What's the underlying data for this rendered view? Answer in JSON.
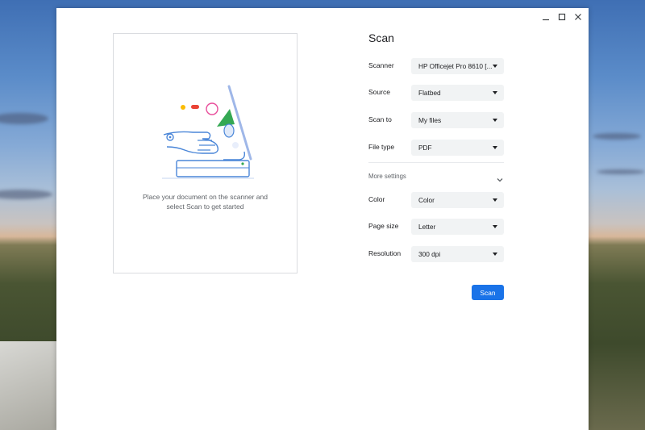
{
  "window_controls": {
    "minimize_icon": "minimize-icon",
    "maximize_icon": "maximize-icon",
    "close_icon": "close-icon"
  },
  "preview": {
    "line1": "Place your document on the scanner and",
    "line2": "select Scan to get started"
  },
  "title": "Scan",
  "fields": {
    "scanner": {
      "label": "Scanner",
      "value": "HP Officejet Pro 8610 [..."
    },
    "source": {
      "label": "Source",
      "value": "Flatbed"
    },
    "scan_to": {
      "label": "Scan to",
      "value": "My files"
    },
    "file_type": {
      "label": "File type",
      "value": "PDF"
    },
    "color": {
      "label": "Color",
      "value": "Color"
    },
    "page_size": {
      "label": "Page size",
      "value": "Letter"
    },
    "resolution": {
      "label": "Resolution",
      "value": "300 dpi"
    }
  },
  "more_settings": {
    "label": "More settings",
    "icon": "chevron-down-icon"
  },
  "scan_button": {
    "label": "Scan"
  },
  "colors": {
    "accent": "#1a73e8",
    "select_bg": "#f1f3f4",
    "illustration_blue": "#4a86d8"
  }
}
